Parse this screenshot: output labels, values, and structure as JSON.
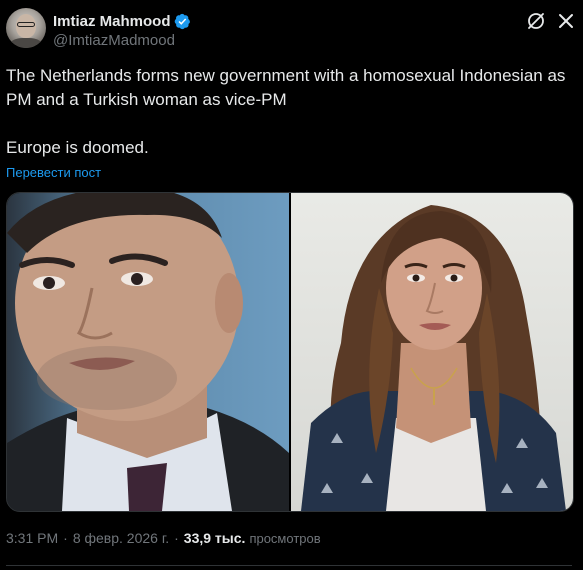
{
  "author": {
    "display_name": "Imtiaz Mahmood",
    "handle": "@ImtiazMadmood",
    "verified": true,
    "verified_color": "#1d9bf0"
  },
  "actions": {
    "grok_icon": "grok-icon",
    "more_icon": "more-icon"
  },
  "tweet": {
    "text": "The Netherlands forms new government with a homosexual Indonesian as PM and a Turkish woman as vice-PM\n\nEurope is doomed.",
    "translate_label": "Перевести пост"
  },
  "media": {
    "photos": [
      {
        "alt": ""
      },
      {
        "alt": ""
      }
    ]
  },
  "meta": {
    "time": "3:31 PM",
    "date": "8 февр. 2026 г.",
    "separator": "·",
    "views_count": "33,9 тыс.",
    "views_label": "просмотров"
  },
  "colors": {
    "background": "#000000",
    "text_primary": "#e7e9ea",
    "text_secondary": "#71767b",
    "link": "#1d9bf0",
    "border": "#2f3336"
  }
}
